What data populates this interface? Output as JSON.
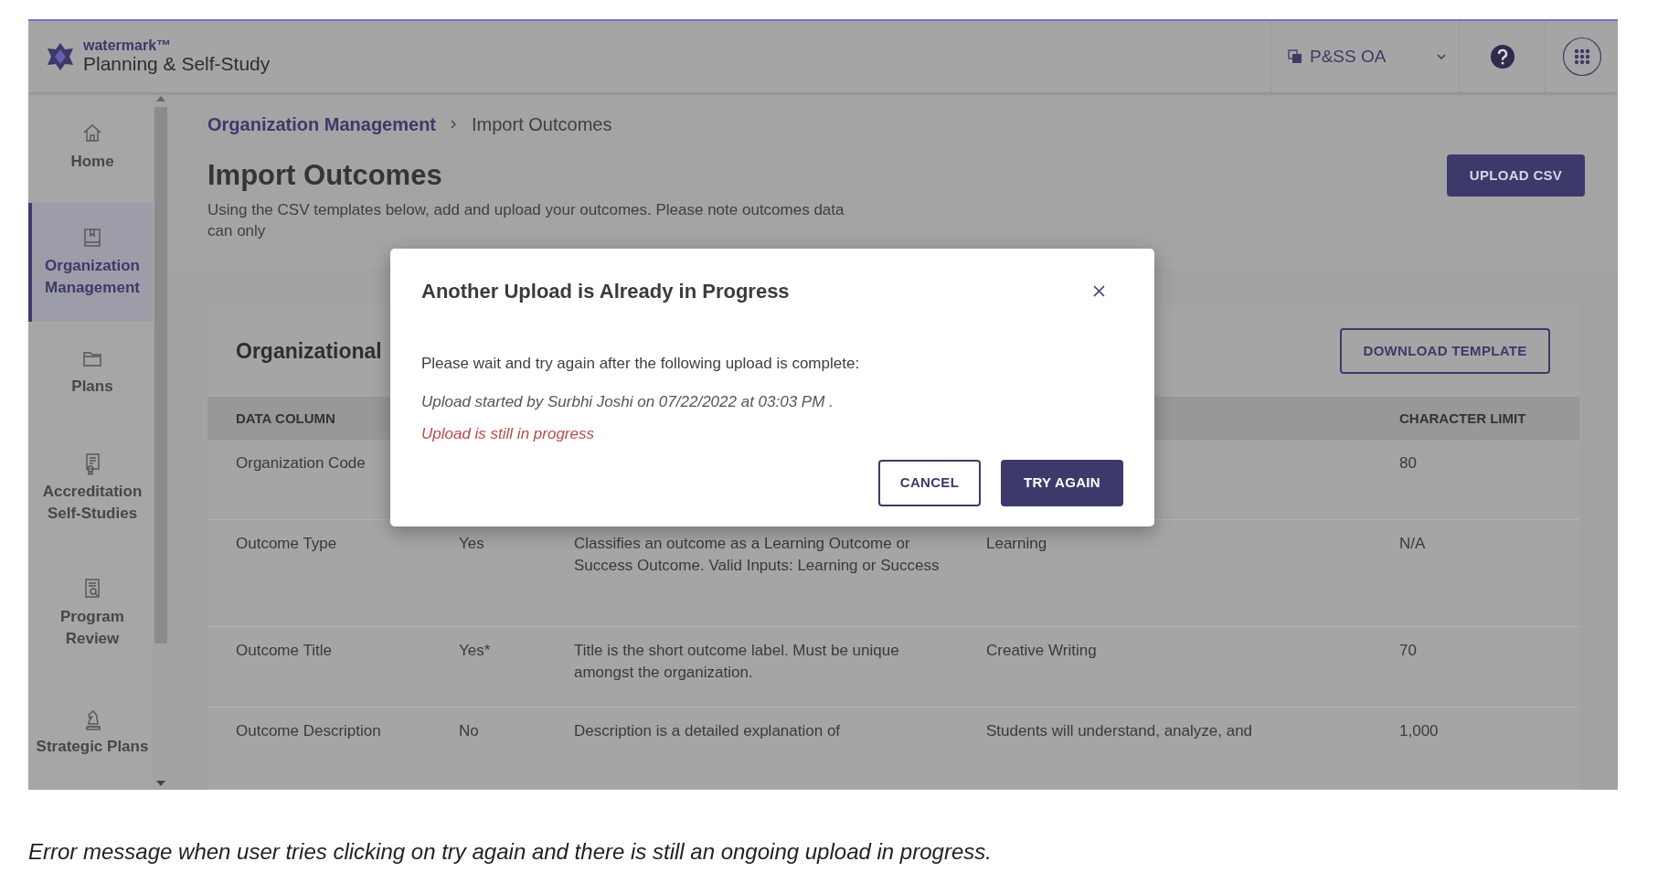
{
  "header": {
    "brand_small": "watermark™",
    "brand": "Planning & Self-Study",
    "org_switcher": {
      "label": "P&SS OA"
    }
  },
  "sidebar": {
    "items": [
      {
        "label": "Home",
        "selected": false
      },
      {
        "label": "Organization Management",
        "selected": true
      },
      {
        "label": "Plans",
        "selected": false
      },
      {
        "label": "Accreditation Self-Studies",
        "selected": false
      },
      {
        "label": "Program Review",
        "selected": false
      },
      {
        "label": "Strategic Plans",
        "selected": false
      }
    ]
  },
  "breadcrumb": [
    {
      "label": "Organization Management",
      "kind": "link"
    },
    {
      "label": "Import Outcomes",
      "kind": "current"
    }
  ],
  "page": {
    "title": "Import Outcomes",
    "description": "Using the CSV templates below, add and upload your outcomes. Please note outcomes data can only",
    "upload_button": "UPLOAD CSV"
  },
  "card": {
    "title": "Organizational",
    "download_button": "DOWNLOAD TEMPLATE",
    "table": {
      "column_1": "DATA COLUMN",
      "column_5": "CHARACTER LIMIT",
      "rows": [
        {
          "column_1": "Organization Code",
          "column_5": "80"
        },
        {
          "column_1": "Outcome Type",
          "column_2": "Yes",
          "column_3": "Classifies an outcome as a Learning Outcome or Success Outcome. Valid Inputs: Learning or Success",
          "column_4": "Learning",
          "column_5": "N/A"
        },
        {
          "column_1": "Outcome Title",
          "column_2": "Yes*",
          "column_3": "Title is the short outcome label. Must be unique amongst the organization.",
          "column_4": "Creative Writing",
          "column_5": "70"
        },
        {
          "column_1": "Outcome Description",
          "column_2": "No",
          "column_3": "Description is a detailed explanation of",
          "column_4": "Students will understand, analyze, and",
          "column_5": "1,000"
        }
      ]
    }
  },
  "modal": {
    "title": "Another Upload is Already in Progress",
    "message": "Please wait and try again after the following upload is complete:",
    "upload_info": "Upload started by Surbhi Joshi on 07/22/2022 at 03:03 PM .",
    "status": "Upload is still in progress",
    "buttons": [
      {
        "label": "CANCEL",
        "kind": "secondary"
      },
      {
        "label": "TRY AGAIN",
        "kind": "primary"
      }
    ]
  },
  "caption": "Error message when user tries clicking on try again and there is still an ongoing upload in progress."
}
